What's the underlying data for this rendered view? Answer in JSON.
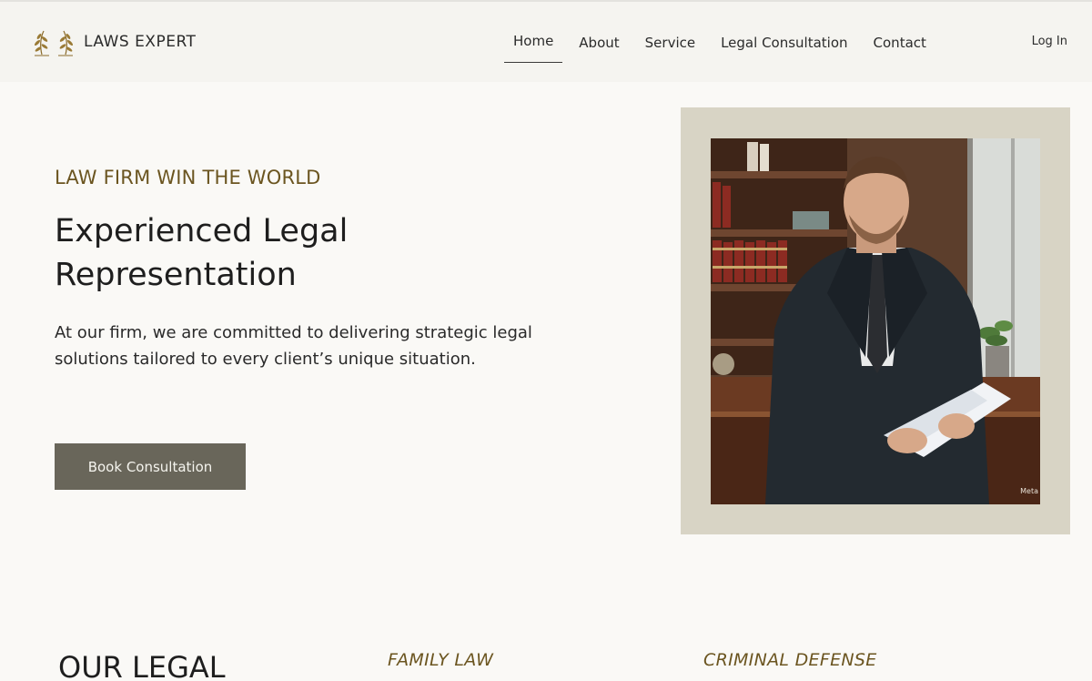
{
  "brand": {
    "name": "LAWS EXPERT",
    "logo_icon": "laurel-icon",
    "accent_color": "#6b5520"
  },
  "nav": {
    "items": [
      {
        "label": "Home",
        "active": true
      },
      {
        "label": "About",
        "active": false
      },
      {
        "label": "Service",
        "active": false
      },
      {
        "label": "Legal Consultation",
        "active": false
      },
      {
        "label": "Contact",
        "active": false
      }
    ],
    "login_label": "Log In"
  },
  "hero": {
    "eyebrow": "LAW FIRM WIN THE WORLD",
    "headline_line1": "Experienced Legal",
    "headline_line2": "Representation",
    "lead_line1": "At our firm, we are committed to delivering strategic legal",
    "lead_line2": "solutions tailored to every client’s unique situation.",
    "cta_label": "Book Consultation",
    "cta_color": "#69665a"
  },
  "photo": {
    "watermark": "Meta"
  },
  "practice": {
    "section_title": "OUR LEGAL",
    "areas": [
      "FAMILY LAW",
      "CRIMINAL DEFENSE"
    ]
  }
}
